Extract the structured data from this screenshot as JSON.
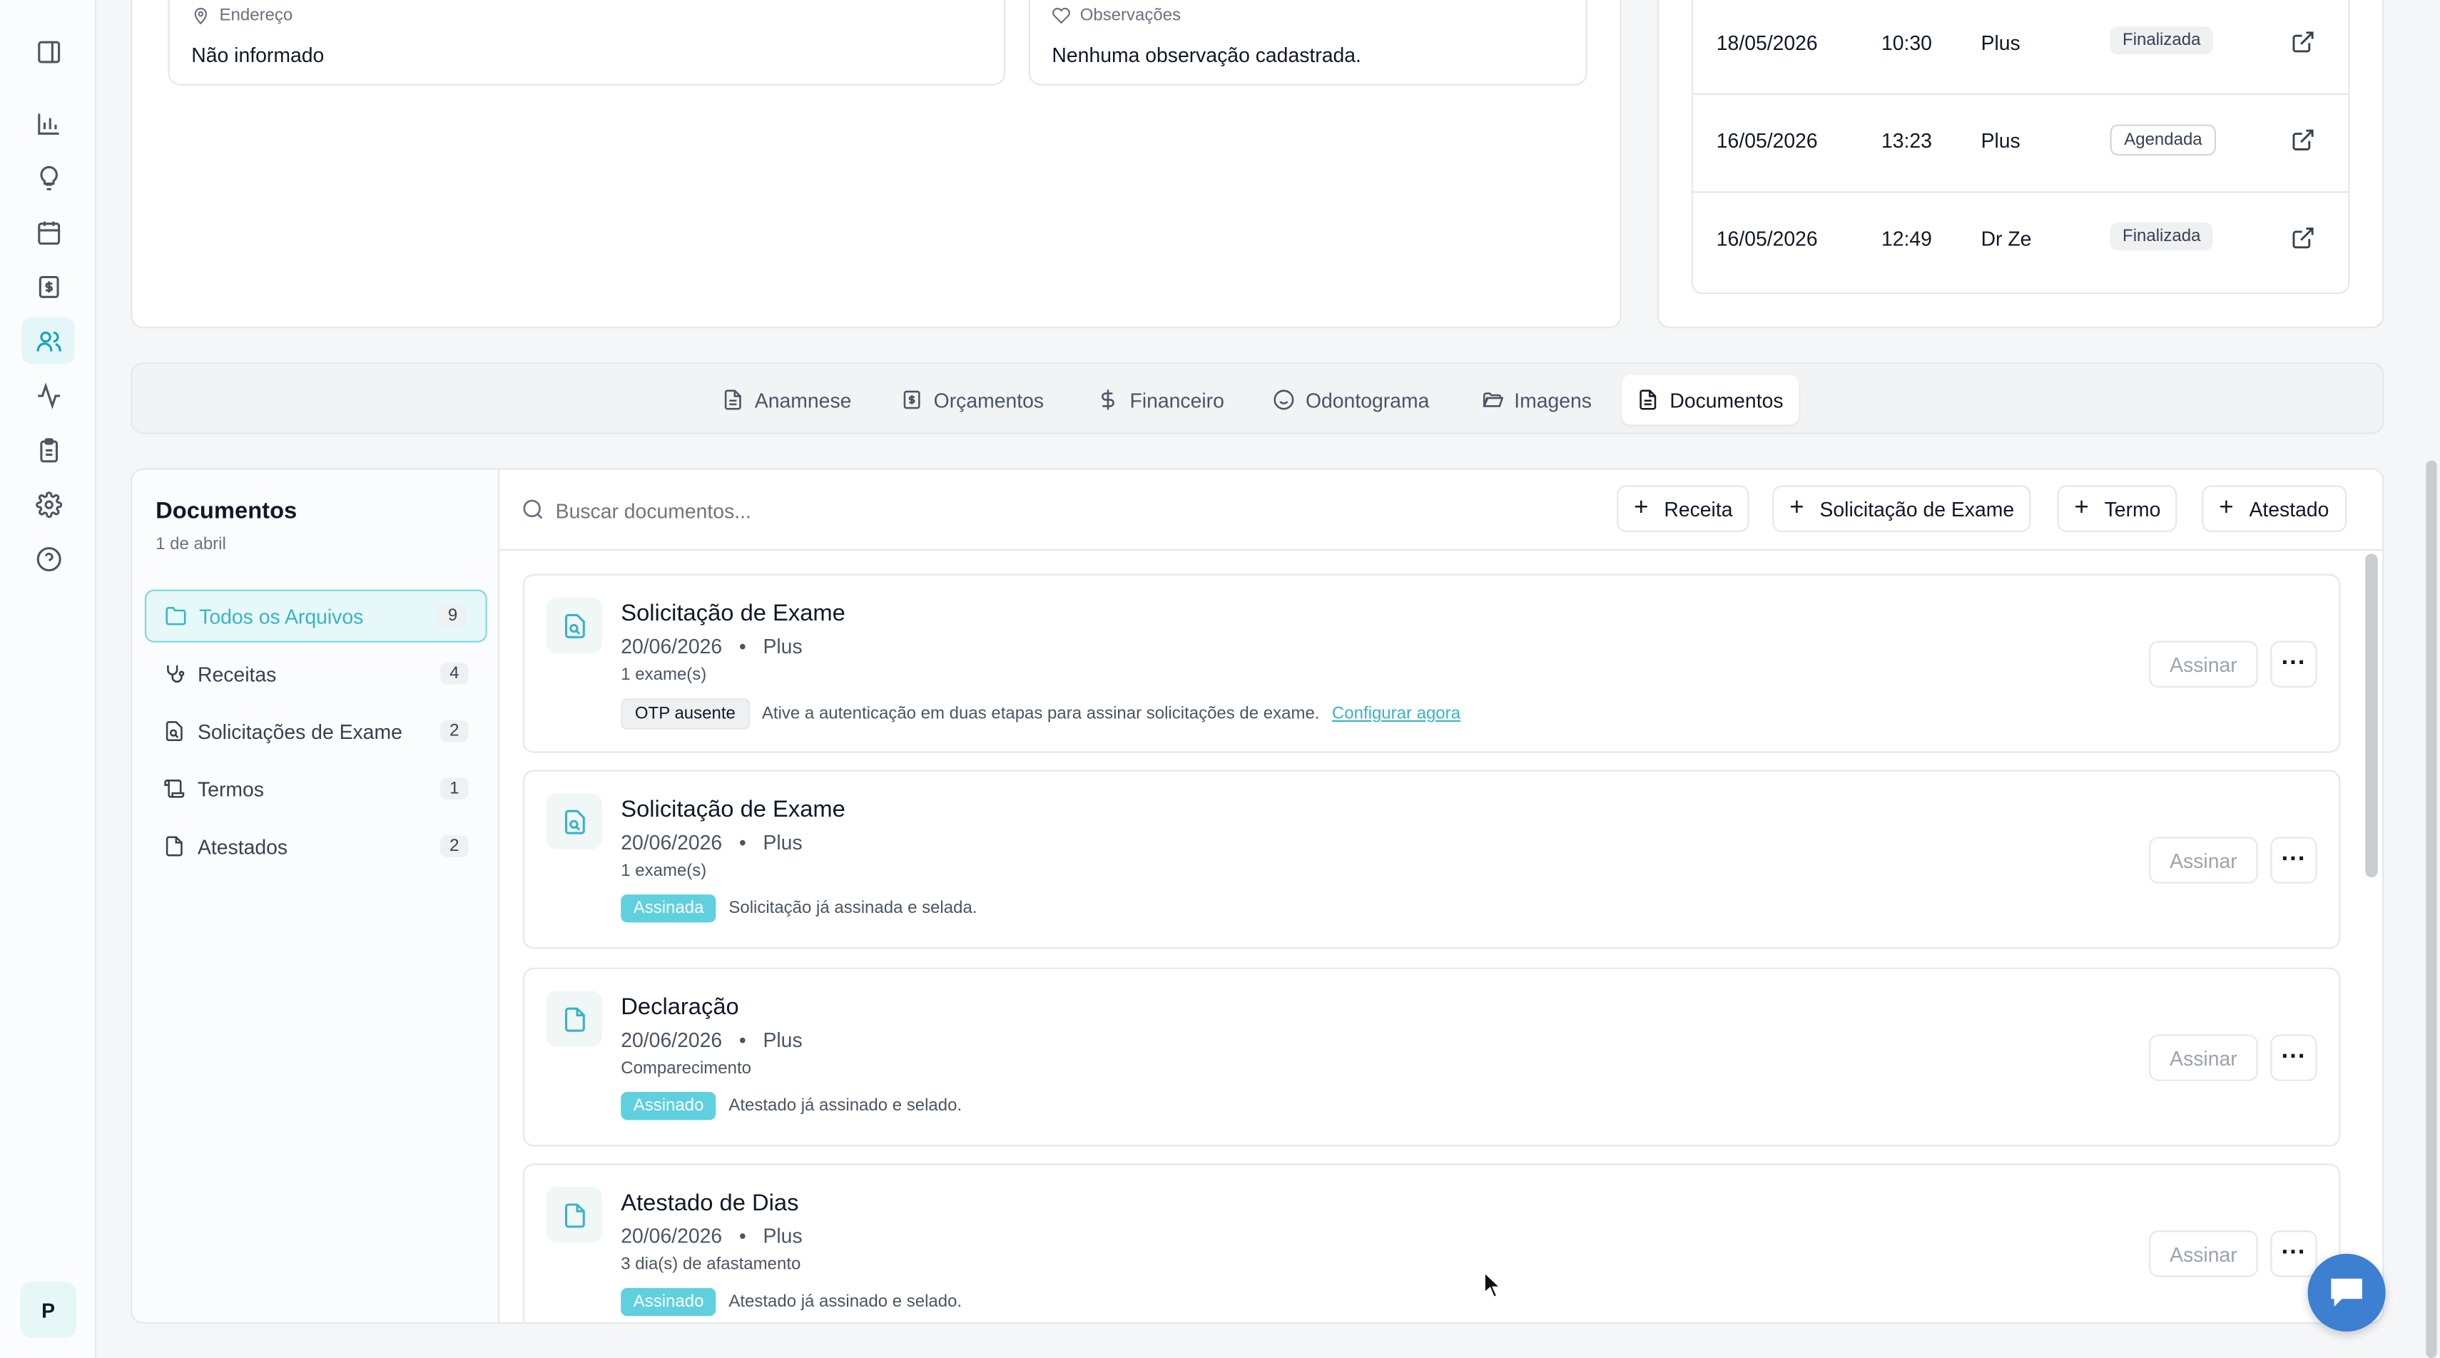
{
  "info": {
    "address_label": "Endereço",
    "address_value": "Não informado",
    "notes_label": "Observações",
    "notes_value": "Nenhuma observação cadastrada."
  },
  "appointments": [
    {
      "date": "18/05/2026",
      "time": "10:30",
      "professional": "Plus",
      "status": "Finalizada"
    },
    {
      "date": "16/05/2026",
      "time": "13:23",
      "professional": "Plus",
      "status": "Agendada"
    },
    {
      "date": "16/05/2026",
      "time": "12:49",
      "professional": "Dr Ze",
      "status": "Finalizada"
    }
  ],
  "tabs": [
    {
      "label": "Anamnese",
      "icon": "file-text-icon"
    },
    {
      "label": "Orçamentos",
      "icon": "receipt-icon"
    },
    {
      "label": "Financeiro",
      "icon": "dollar-icon"
    },
    {
      "label": "Odontograma",
      "icon": "smile-icon"
    },
    {
      "label": "Imagens",
      "icon": "folder-open-icon"
    },
    {
      "label": "Documentos",
      "icon": "file-icon",
      "active": true
    }
  ],
  "documents": {
    "title": "Documentos",
    "subtitle": "1 de abril",
    "search_placeholder": "Buscar documentos...",
    "categories": [
      {
        "label": "Todos os Arquivos",
        "count": "9",
        "active": true
      },
      {
        "label": "Receitas",
        "count": "4"
      },
      {
        "label": "Solicitações de Exame",
        "count": "2"
      },
      {
        "label": "Termos",
        "count": "1"
      },
      {
        "label": "Atestados",
        "count": "2"
      }
    ],
    "actions": {
      "receita": "Receita",
      "exame": "Solicitação de Exame",
      "termo": "Termo",
      "atestado": "Atestado"
    },
    "items": [
      {
        "title": "Solicitação de Exame",
        "date": "20/06/2026",
        "author": "Plus",
        "sub": "1 exame(s)",
        "badge": "OTP ausente",
        "message": "Ative a autenticação em duas etapas para assinar solicitações de exame.",
        "link": "Configurar agora"
      },
      {
        "title": "Solicitação de Exame",
        "date": "20/06/2026",
        "author": "Plus",
        "sub": "1 exame(s)",
        "badge": "Assinada",
        "message": "Solicitação já assinada e selada."
      },
      {
        "title": "Declaração",
        "date": "20/06/2026",
        "author": "Plus",
        "sub": "Comparecimento",
        "badge": "Assinado",
        "message": "Atestado já assinado e selado."
      },
      {
        "title": "Atestado de Dias",
        "date": "20/06/2026",
        "author": "Plus",
        "sub": "3 dia(s) de afastamento",
        "badge": "Assinado",
        "message": "Atestado já assinado e selado."
      }
    ],
    "sign_label": "Assinar",
    "dot_separator": "•"
  },
  "user_avatar": "P"
}
